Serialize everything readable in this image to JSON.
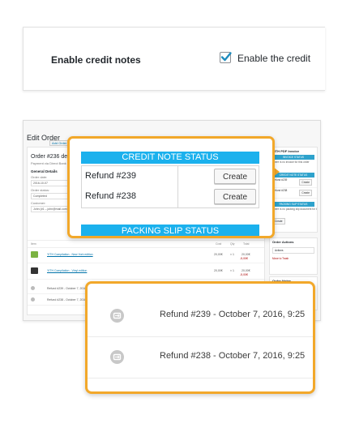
{
  "settings": {
    "label": "Enable credit notes",
    "checkbox_text": "Enable the credit",
    "checked": true
  },
  "admin": {
    "page_title": "Edit Order",
    "page_title_button": "Add Order",
    "order_title": "Order #236 details",
    "order_sub": "Payment via Direct Bank",
    "general_head": "General Details",
    "order_date_label": "Order date:",
    "order_date": "2016-10-07",
    "order_status_label": "Order status:",
    "order_status": "Completed",
    "customer_label": "Customer:",
    "customer": "John (#1 – john@mail.com)",
    "items_headers": {
      "item": "Item",
      "cost": "Cost",
      "qty": "Qty",
      "total": "Total"
    },
    "items": [
      {
        "name": "YITH Compilation - New York edition",
        "cost": "20,00€",
        "qty": "× 1",
        "total": "20,00€",
        "refund": "-5,00€",
        "color": "#7bb342"
      },
      {
        "name": "YITH Compilation - Vinyl edition",
        "cost": "20,00€",
        "qty": "× 1",
        "total": "20,00€",
        "refund": "-5,00€",
        "color": "#333333"
      }
    ],
    "refund_rows": [
      "Refund #239 - October 7, 2016, 9:25",
      "Refund #238 - October 7, 2016, 9:25"
    ],
    "sidebar": {
      "invoice_box_title": "YITH PDF Invoice",
      "invoice_status": "INVOICE STATUS",
      "invoice_note": "There is no invoice for this order",
      "credit_status": "CREDIT NOTE STATUS",
      "credit_rows": [
        "Refund #239",
        "Refund #238"
      ],
      "credit_button": "Create",
      "packing_status": "PACKING SLIP STATUS",
      "packing_note": "There is no packing slip document for this order.",
      "packing_button": "Create",
      "actions_title": "Order Actions",
      "actions_select": "Actions",
      "move_to_trash": "Move to Trash",
      "notes_title": "Order Notes"
    }
  },
  "status_callout": {
    "credit_header": "CREDIT NOTE STATUS",
    "rows": [
      {
        "label": "Refund #239",
        "button": "Create"
      },
      {
        "label": "Refund #238",
        "button": "Create"
      }
    ],
    "packing_header": "PACKING SLIP STATUS"
  },
  "refund_callout": {
    "rows": [
      "Refund #239 - October 7, 2016, 9:25",
      "Refund #238 - October 7, 2016, 9:25"
    ]
  },
  "colors": {
    "accent_blue": "#1bb1ed",
    "callout_orange": "#f2a82a",
    "checkbox_check": "#1e8cbe"
  },
  "icons": {
    "checkbox": "checkmark-icon",
    "refund": "refund-icon"
  }
}
